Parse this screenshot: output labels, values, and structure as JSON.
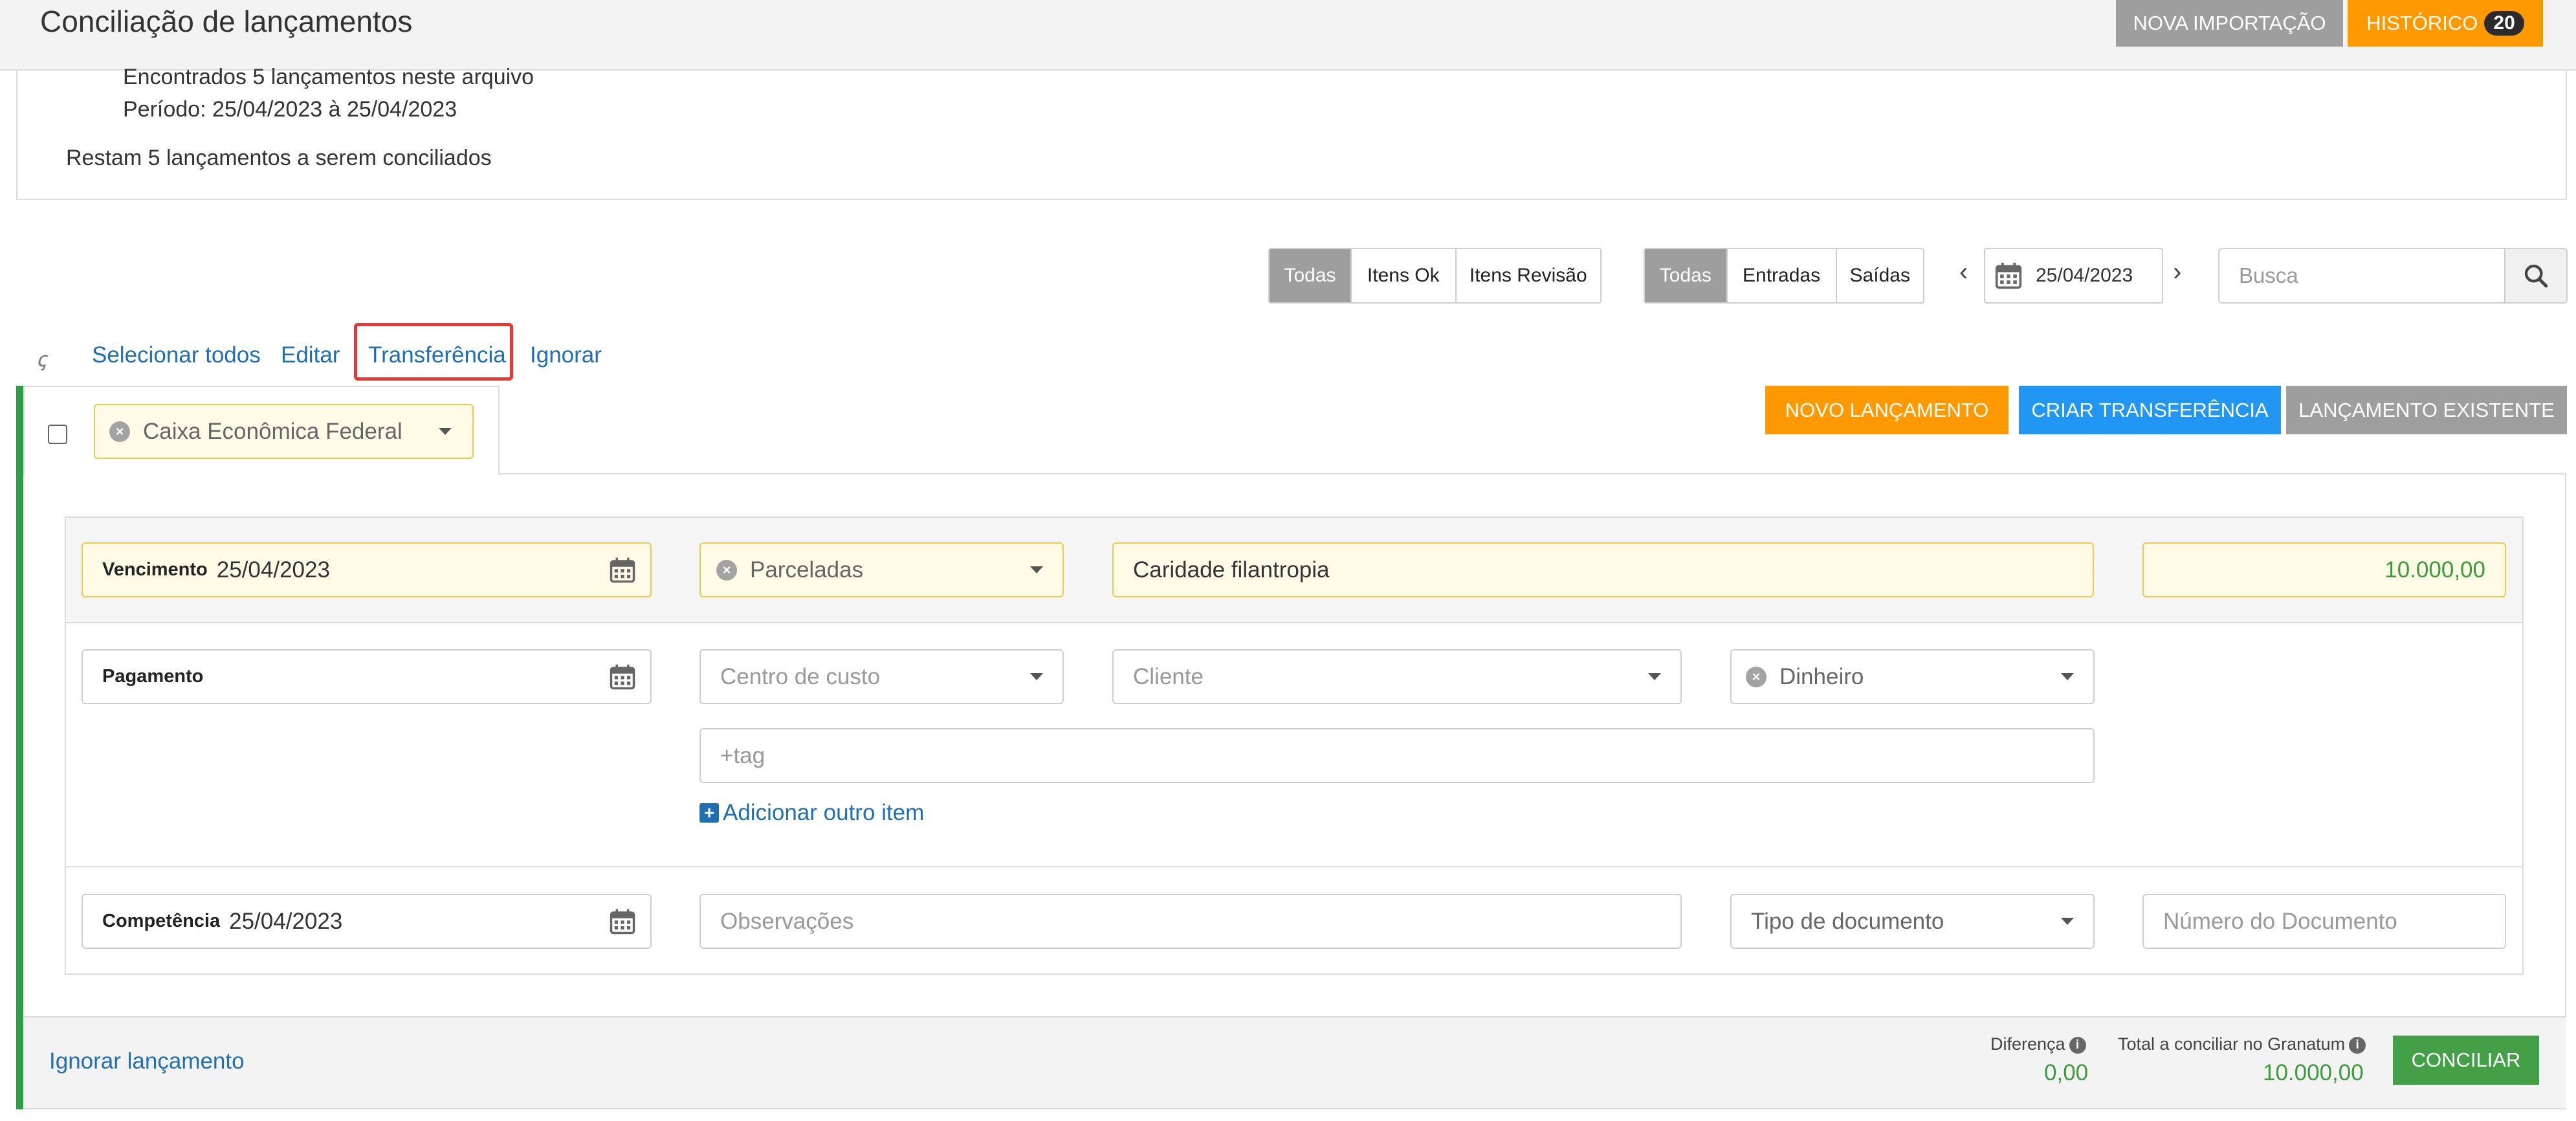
{
  "header": {
    "title": "Conciliação de lançamentos",
    "import_label": "NOVA IMPORTAÇÃO",
    "history_label": "HISTÓRICO",
    "history_count": "20"
  },
  "info": {
    "found": "Encontrados 5 lançamentos neste arquivo",
    "period": "Período: 25/04/2023 à 25/04/2023",
    "remaining": "Restam 5 lançamentos a serem conciliados"
  },
  "filters": {
    "status": [
      "Todas",
      "Itens Ok",
      "Itens Revisão"
    ],
    "status_selected": "Todas",
    "direction": [
      "Todas",
      "Entradas",
      "Saídas"
    ],
    "direction_selected": "Todas",
    "date": "25/04/2023",
    "search_placeholder": "Busca"
  },
  "actions": {
    "select_all": "Selecionar todos",
    "edit": "Editar",
    "transfer": "Transferência",
    "ignore": "Ignorar"
  },
  "card": {
    "account": "Caixa Econômica Federal",
    "buttons": {
      "novo": "NOVO LANÇAMENTO",
      "criar_transferencia": "CRIAR TRANSFERÊNCIA",
      "existente": "LANÇAMENTO EXISTENTE"
    },
    "vencimento_label": "Vencimento",
    "vencimento_value": "25/04/2023",
    "parcelas": "Parceladas",
    "description": "Caridade filantropia",
    "amount": "10.000,00",
    "pagamento_label": "Pagamento",
    "centro_custo_placeholder": "Centro de custo",
    "cliente_placeholder": "Cliente",
    "forma_pagamento": "Dinheiro",
    "tag_placeholder": "+tag",
    "add_item": "Adicionar outro item",
    "competencia_label": "Competência",
    "competencia_value": "25/04/2023",
    "observacoes_placeholder": "Observações",
    "tipo_documento_placeholder": "Tipo de documento",
    "numero_documento_placeholder": "Número do Documento"
  },
  "footer": {
    "ignore_link": "Ignorar lançamento",
    "diferenca_label": "Diferença",
    "diferenca_value": "0,00",
    "total_label": "Total a conciliar no Granatum",
    "total_value": "10.000,00",
    "conciliar_label": "CONCILIAR"
  },
  "colors": {
    "orange": "#ff9900",
    "blue": "#2196f3",
    "grey_button": "#9e9e9e",
    "green": "#43a047",
    "link": "#1f6fb2",
    "highlight": "#e53935"
  }
}
